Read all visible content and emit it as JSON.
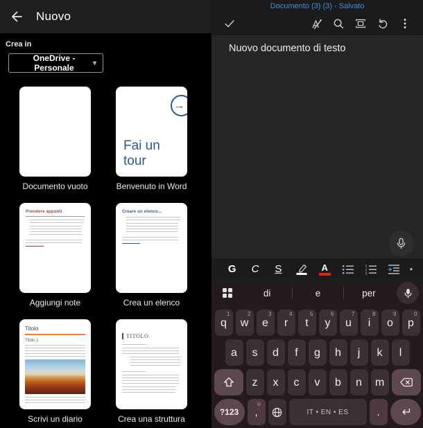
{
  "left_panel": {
    "title": "Nuovo",
    "create_in_label": "Crea in",
    "location_dropdown": "OneDrive - Personale",
    "templates": [
      {
        "label": "Documento vuoto",
        "type": "blank"
      },
      {
        "label": "Benvenuto in Word",
        "type": "tour",
        "tour_text": "Fai un tour"
      },
      {
        "label": "Aggiungi note",
        "type": "notes",
        "preview_heading": "Prendere appunti"
      },
      {
        "label": "Crea un elenco",
        "type": "list",
        "preview_heading": "Creare un elenco..."
      },
      {
        "label": "Scrivi un diario",
        "type": "journal",
        "preview_heading": "Titolo",
        "preview_subheading": "Titolo 1"
      },
      {
        "label": "Crea una struttura",
        "type": "outline",
        "preview_heading": "TITOLO"
      }
    ]
  },
  "right_panel": {
    "doc_title": "Documento (3) (3) - Salvato",
    "document_text": "Nuovo documento di testo",
    "format_bar": {
      "bold_label": "G",
      "italic_label": "C",
      "underline_label": "S"
    }
  },
  "keyboard": {
    "suggestions": [
      "di",
      "e",
      "per"
    ],
    "row1": [
      {
        "k": "q",
        "n": "1"
      },
      {
        "k": "w",
        "n": "2"
      },
      {
        "k": "e",
        "n": "3"
      },
      {
        "k": "r",
        "n": "4"
      },
      {
        "k": "t",
        "n": "5"
      },
      {
        "k": "y",
        "n": "6"
      },
      {
        "k": "u",
        "n": "7"
      },
      {
        "k": "i",
        "n": "8"
      },
      {
        "k": "o",
        "n": "9"
      },
      {
        "k": "p",
        "n": "0"
      }
    ],
    "row2": [
      "a",
      "s",
      "d",
      "f",
      "g",
      "h",
      "j",
      "k",
      "l"
    ],
    "row3": [
      "z",
      "x",
      "c",
      "v",
      "b",
      "n",
      "m"
    ],
    "symbols_label": "?123",
    "comma_label": ",",
    "comma_sup": "☺",
    "space_label": "IT • EN • ES",
    "period_label": "."
  },
  "icons": {
    "caret": "▾",
    "tour_arrow": "→",
    "collapse": "▲",
    "outline_dots": "..."
  },
  "colors": {
    "word_blue": "#2b579a",
    "doc_title_blue": "#4190dd",
    "font_color_red": "#e3201c",
    "journal_rule_orange": "#ed7d31",
    "notes_heading_maroon": "#9c4343"
  }
}
